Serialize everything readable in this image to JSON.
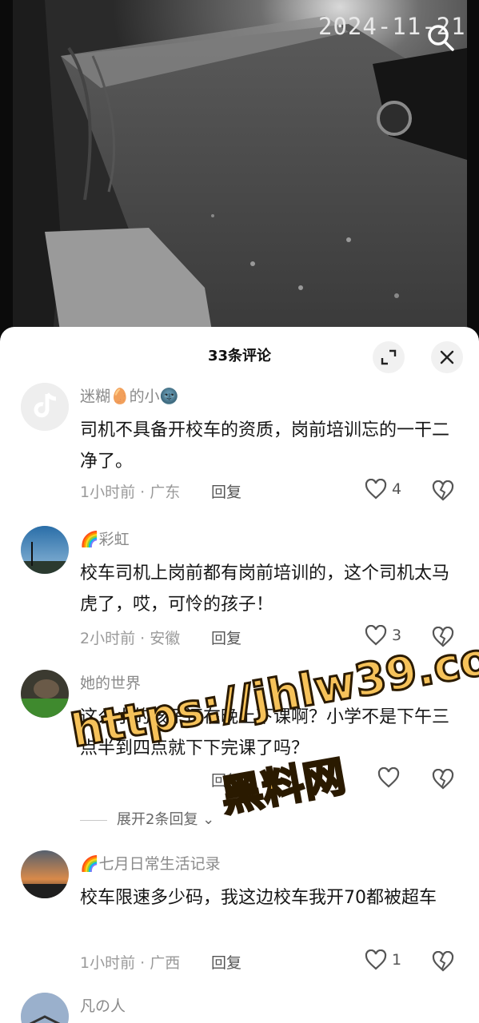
{
  "video": {
    "timestamp": "2024-11-21"
  },
  "sheet": {
    "title": "33条评论"
  },
  "comments": [
    {
      "username": "迷糊🥚的小🌚",
      "text": "司机不具备开校车的资质，岗前培训忘的一干二净了。",
      "meta": "1小时前 · 广东",
      "reply": "回复",
      "likes": "4"
    },
    {
      "username": "🌈彩虹",
      "text": "校车司机上岗前都有岗前培训的，这个司机太马虎了，哎，可怜的孩子！",
      "meta": "2小时前 · 安徽",
      "reply": "回复",
      "likes": "3"
    },
    {
      "username": "她的世界",
      "text": "这么小的孩子还在晚上下课啊？小学不是下午三点半到四点就下下完课了吗？",
      "meta": "",
      "reply": "回复",
      "likes": "",
      "expand": "展开2条回复"
    },
    {
      "username": "🌈七月日常生活记录",
      "text": "校车限速多少码，我这边校车我开70都被超车",
      "meta": "1小时前 · 广西",
      "reply": "回复",
      "likes": "1"
    },
    {
      "username": "凡の人"
    }
  ],
  "watermark": {
    "line1": "https://jhlw39.com",
    "line2": "黑料网"
  },
  "icons": {
    "search": "search-icon",
    "expand": "expand-icon",
    "close": "close-icon",
    "like": "heart-icon",
    "dislike": "broken-heart-icon"
  }
}
